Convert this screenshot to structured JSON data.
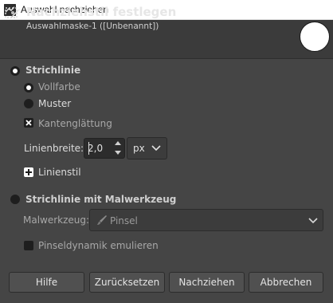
{
  "window": {
    "title": "Auswahl nachziehen"
  },
  "header": {
    "heading": "Nachziehstil festlegen",
    "subheading": "Auswahlmaske-1 ([Unbenannt])"
  },
  "stroke_line": {
    "label": "Strichlinie",
    "solid_color_label": "Vollfarbe",
    "pattern_label": "Muster",
    "antialiasing_label": "Kantenglättung",
    "line_width_label": "Linienbreite:",
    "line_width_value": "2,0",
    "unit_value": "px",
    "line_style_label": "Linienstil"
  },
  "stroke_paint_tool": {
    "label": "Strichlinie mit Malwerkzeug",
    "paint_tool_label": "Malwerkzeug:",
    "paint_tool_value": "Pinsel",
    "brush_dynamics_label": "Pinseldynamik emulieren"
  },
  "buttons": {
    "help": "Hilfe",
    "reset": "Zurücksetzen",
    "stroke": "Nachziehen",
    "cancel": "Abbrechen"
  }
}
